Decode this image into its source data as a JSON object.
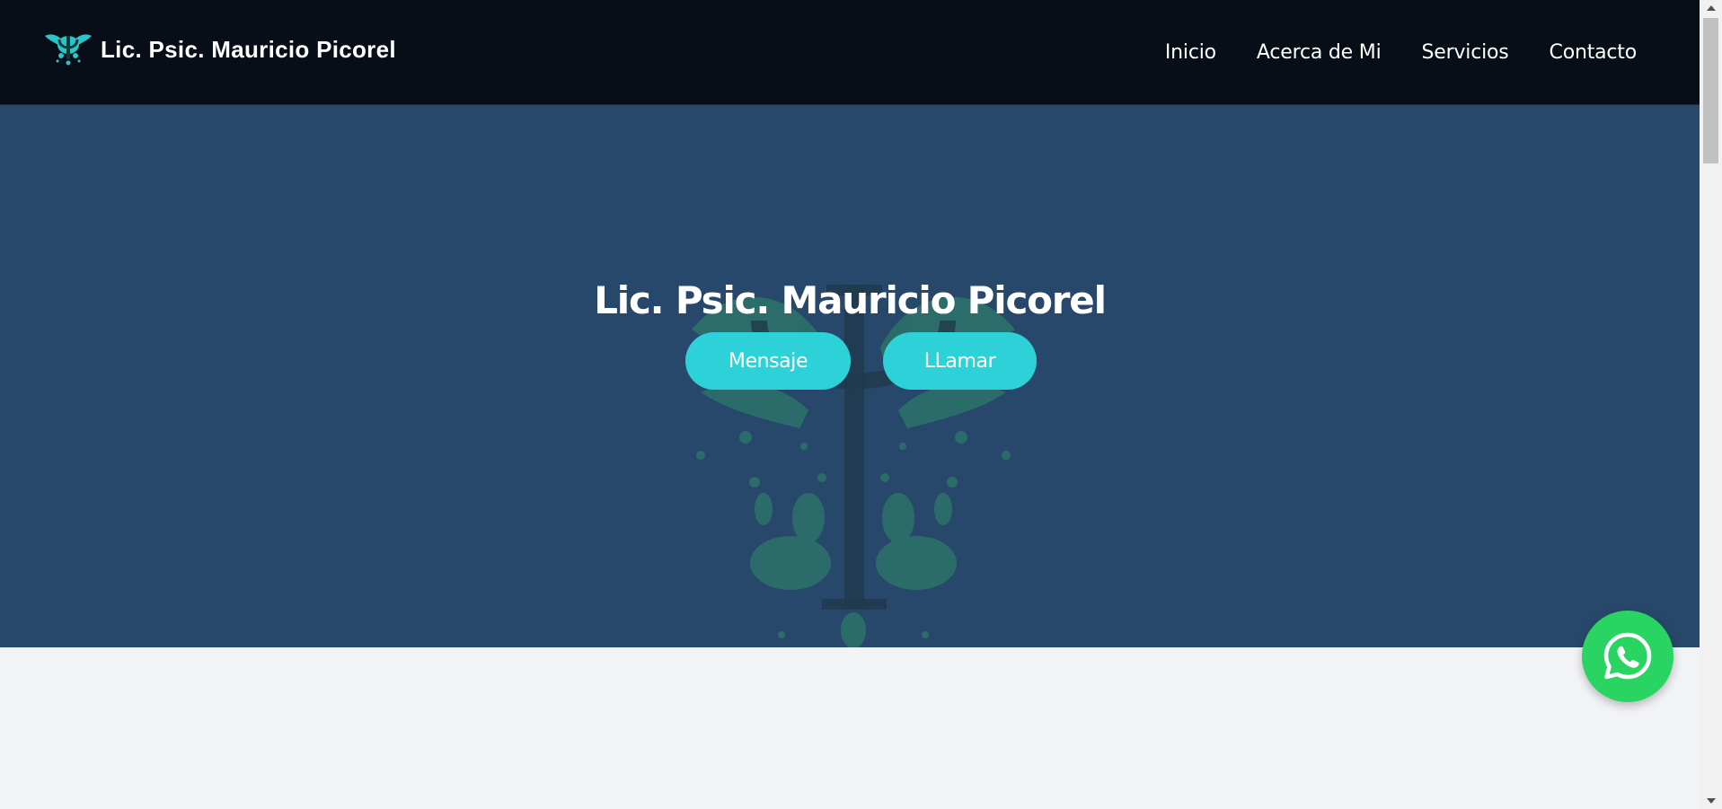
{
  "header": {
    "brand_text": "Lic. Psic. Mauricio Picorel",
    "nav": [
      {
        "label": "Inicio"
      },
      {
        "label": "Acerca de Mi"
      },
      {
        "label": "Servicios"
      },
      {
        "label": "Contacto"
      }
    ]
  },
  "hero": {
    "title": "Lic. Psic. Mauricio Picorel",
    "buttons": {
      "message_label": "Mensaje",
      "call_label": "LLamar"
    }
  },
  "floating": {
    "icon": "whatsapp-icon"
  },
  "colors": {
    "header_bg": "#070e17",
    "hero_bg": "#28486b",
    "accent": "#2dd1d8",
    "whatsapp": "#29d463",
    "page_bg": "#f2f3f5"
  }
}
